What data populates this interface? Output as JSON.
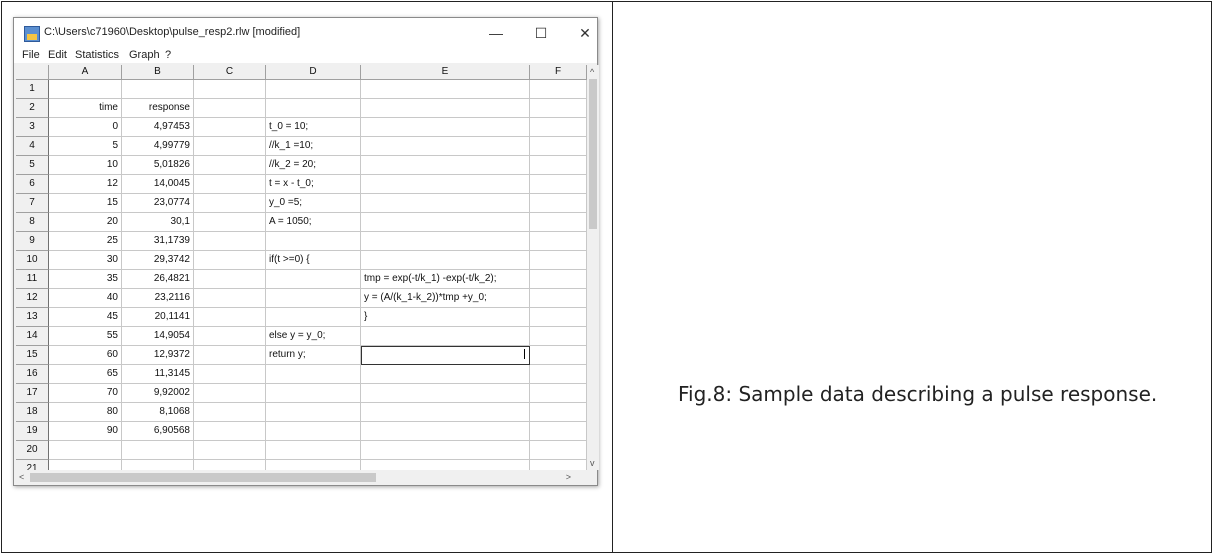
{
  "window": {
    "title": "C:\\Users\\c71960\\Desktop\\pulse_resp2.rlw [modified]",
    "minimize": "—",
    "maximize": "☐",
    "close": "✕"
  },
  "menu": [
    "File",
    "Edit",
    "Statistics",
    "Graph",
    "?"
  ],
  "columns": [
    "A",
    "B",
    "C",
    "D",
    "E",
    "F"
  ],
  "rows": [
    {
      "n": "1",
      "a": "",
      "b": "",
      "d": "",
      "e": ""
    },
    {
      "n": "2",
      "a": "time",
      "b": "response",
      "d": "",
      "e": ""
    },
    {
      "n": "3",
      "a": "0",
      "b": "4,97453",
      "d": "t_0 = 10;",
      "e": ""
    },
    {
      "n": "4",
      "a": "5",
      "b": "4,99779",
      "d": "//k_1 =10;",
      "e": ""
    },
    {
      "n": "5",
      "a": "10",
      "b": "5,01826",
      "d": "//k_2 = 20;",
      "e": ""
    },
    {
      "n": "6",
      "a": "12",
      "b": "14,0045",
      "d": "t = x - t_0;",
      "e": ""
    },
    {
      "n": "7",
      "a": "15",
      "b": "23,0774",
      "d": "y_0 =5;",
      "e": ""
    },
    {
      "n": "8",
      "a": "20",
      "b": "30,1",
      "d": "A = 1050;",
      "e": ""
    },
    {
      "n": "9",
      "a": "25",
      "b": "31,1739",
      "d": "",
      "e": ""
    },
    {
      "n": "10",
      "a": "30",
      "b": "29,3742",
      "d": "if(t >=0) {",
      "e": ""
    },
    {
      "n": "11",
      "a": "35",
      "b": "26,4821",
      "d": "",
      "e": "tmp = exp(-t/k_1) -exp(-t/k_2);"
    },
    {
      "n": "12",
      "a": "40",
      "b": "23,2116",
      "d": "",
      "e": "y = (A/(k_1-k_2))*tmp +y_0;"
    },
    {
      "n": "13",
      "a": "45",
      "b": "20,1141",
      "d": "",
      "e": "}"
    },
    {
      "n": "14",
      "a": "55",
      "b": "14,9054",
      "d": "else y = y_0;",
      "e": ""
    },
    {
      "n": "15",
      "a": "60",
      "b": "12,9372",
      "d": "return y;",
      "e": ""
    },
    {
      "n": "16",
      "a": "65",
      "b": "11,3145",
      "d": "",
      "e": ""
    },
    {
      "n": "17",
      "a": "70",
      "b": "9,92002",
      "d": "",
      "e": ""
    },
    {
      "n": "18",
      "a": "80",
      "b": "8,1068",
      "d": "",
      "e": ""
    },
    {
      "n": "19",
      "a": "90",
      "b": "6,90568",
      "d": "",
      "e": ""
    },
    {
      "n": "20",
      "a": "",
      "b": "",
      "d": "",
      "e": ""
    },
    {
      "n": "21",
      "a": "",
      "b": "",
      "d": "",
      "e": ""
    }
  ],
  "active_cell": "E15",
  "scroll": {
    "up": "^",
    "down": "v",
    "left": "<",
    "right": ">"
  },
  "caption": "Fig.8: Sample data describing a pulse response."
}
